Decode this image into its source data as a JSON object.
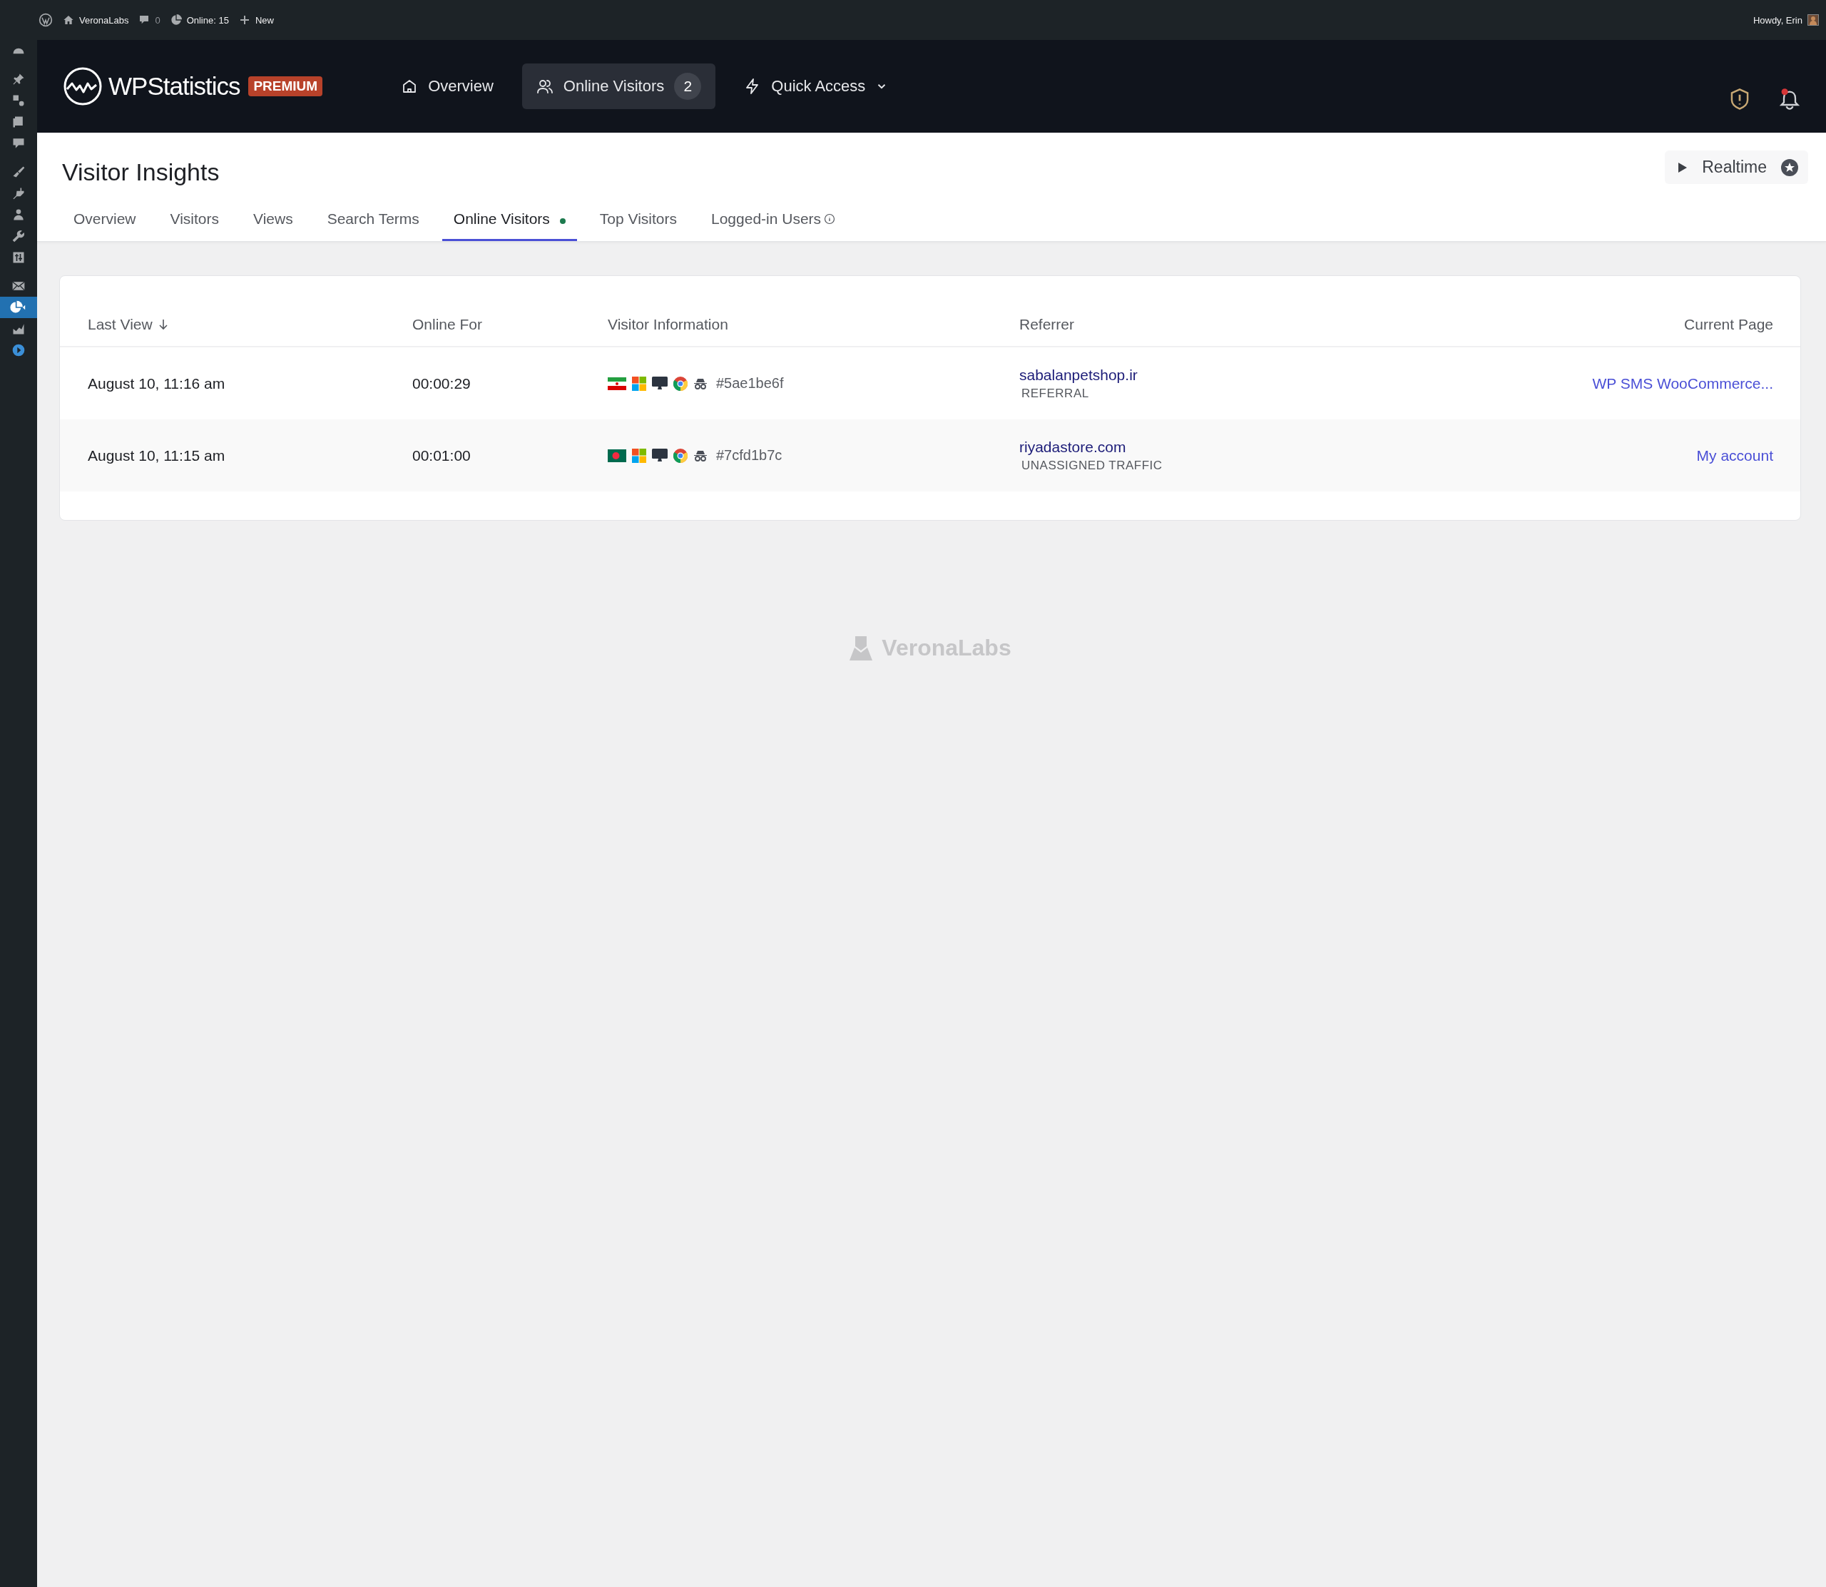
{
  "admin_bar": {
    "site_name": "VeronaLabs",
    "comments_count": "0",
    "online": "Online: 15",
    "new_label": "New",
    "greeting": "Howdy, Erin"
  },
  "sidebar": {
    "items": [
      {
        "kind": "dashboard",
        "selected": false
      },
      {
        "kind": "pin",
        "selected": false
      },
      {
        "kind": "media",
        "selected": false
      },
      {
        "kind": "pages",
        "selected": false
      },
      {
        "kind": "comments",
        "selected": false
      },
      {
        "kind": "brush",
        "selected": false
      },
      {
        "kind": "plug",
        "selected": false
      },
      {
        "kind": "user",
        "selected": false
      },
      {
        "kind": "wrench",
        "selected": false
      },
      {
        "kind": "sliders",
        "selected": false
      },
      {
        "kind": "mail",
        "selected": false
      },
      {
        "kind": "pie",
        "selected": true
      },
      {
        "kind": "chart",
        "selected": false
      },
      {
        "kind": "play",
        "selected": false
      }
    ]
  },
  "header": {
    "logo_text": "WPStatistics",
    "badge": "PREMIUM",
    "nav": [
      {
        "kind": "home",
        "label": "Overview",
        "selected": false
      },
      {
        "kind": "users",
        "label": "Online Visitors",
        "count": "2",
        "selected": true
      },
      {
        "kind": "bolt",
        "label": "Quick Access",
        "dropdown": true,
        "selected": false
      }
    ]
  },
  "page": {
    "title": "Visitor Insights",
    "realtime_button": "Realtime",
    "tabs": [
      {
        "label": "Overview",
        "selected": false
      },
      {
        "label": "Visitors",
        "selected": false
      },
      {
        "label": "Views",
        "selected": false
      },
      {
        "label": "Search Terms",
        "selected": false
      },
      {
        "label": "Online Visitors",
        "selected": true,
        "live_dot": true
      },
      {
        "label": "Top Visitors",
        "selected": false
      },
      {
        "label": "Logged-in Users",
        "selected": false,
        "info": true
      }
    ]
  },
  "table": {
    "columns": [
      {
        "label": "Last View",
        "sorted": true
      },
      {
        "label": "Online For",
        "sorted": false
      },
      {
        "label": "Visitor Information",
        "sorted": false
      },
      {
        "label": "Referrer",
        "sorted": false
      },
      {
        "label": "Current Page",
        "sorted": false
      }
    ],
    "rows": [
      {
        "last_view": "August 10, 11:16 am",
        "online_for": "00:00:29",
        "kind": "iran",
        "visitor_id": "#5ae1be6f",
        "referrer": "sabalanpetshop.ir",
        "referrer_type": "REFERRAL",
        "current_page": "WP SMS WooCommerce..."
      },
      {
        "last_view": "August 10, 11:15 am",
        "online_for": "00:01:00",
        "kind": "bangladesh",
        "visitor_id": "#7cfd1b7c",
        "referrer": "riyadastore.com",
        "referrer_type": "UNASSIGNED TRAFFIC",
        "current_page": "My account"
      }
    ]
  },
  "footer": {
    "brand": "VeronaLabs"
  }
}
